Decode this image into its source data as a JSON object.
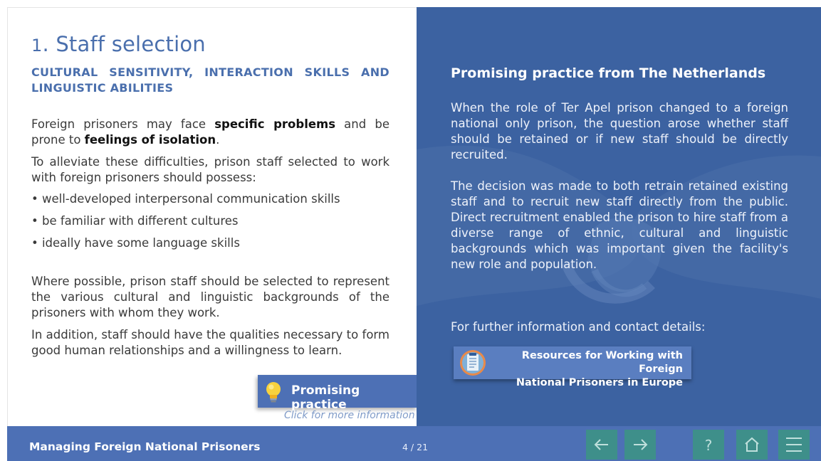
{
  "slide": {
    "title_number": "1",
    "title_text": ". Staff selection",
    "subtitle": "CULTURAL SENSITIVITY, INTERACTION SKILLS AND LINGUISTIC ABILITIES",
    "para1": {
      "t1": "Foreign prisoners may face ",
      "b1": "specific problems",
      "t2": " and be prone to ",
      "b2": "feelings of isolation",
      "t3": "."
    },
    "para2": "To alleviate these difficulties, prison staff selected to work with foreign prisoners should possess:",
    "bullets": [
      "• well-developed interpersonal communication skills",
      "• be familiar with different cultures",
      "• ideally have some language skills"
    ],
    "para3": "Where possible, prison staff should be selected to represent the various cultural and linguistic backgrounds of the prisoners with whom they work.",
    "para4": "In addition, staff should have the qualities necessary to form good human relationships and a willingness to learn.",
    "promising_button_label": "Promising practice",
    "click_hint": "Click for more information"
  },
  "panel": {
    "heading": "Promising practice from The Netherlands",
    "para1": "When the role of Ter Apel prison changed to a foreign national only prison, the question arose whether staff should be retained or if new staff should be directly recruited.",
    "para2": "The decision was made to both retrain retained existing staff and to recruit new staff directly from the public. Direct recruitment enabled the prison to hire staff from a diverse range of ethnic, cultural and linguistic backgrounds which was important given the facility's new role and population.",
    "contact_text": "For further information and contact details:",
    "resource_line1": "Resources for Working with Foreign",
    "resource_line2": "National Prisoners in Europe"
  },
  "footer": {
    "course_title": "Managing Foreign National Prisoners",
    "page_indicator": "4 / 21",
    "help_glyph": "?"
  },
  "colors": {
    "accent_blue": "#4a6fad",
    "panel_blue": "#3c62a1",
    "footer_blue": "#4d70b5",
    "nav_teal": "#3e8f8a"
  },
  "icons": {
    "bulb": "lightbulb-icon",
    "resource": "document-icon",
    "prev": "arrow-left-icon",
    "next": "arrow-right-icon",
    "help": "question-icon",
    "home": "home-icon",
    "menu": "menu-icon"
  }
}
